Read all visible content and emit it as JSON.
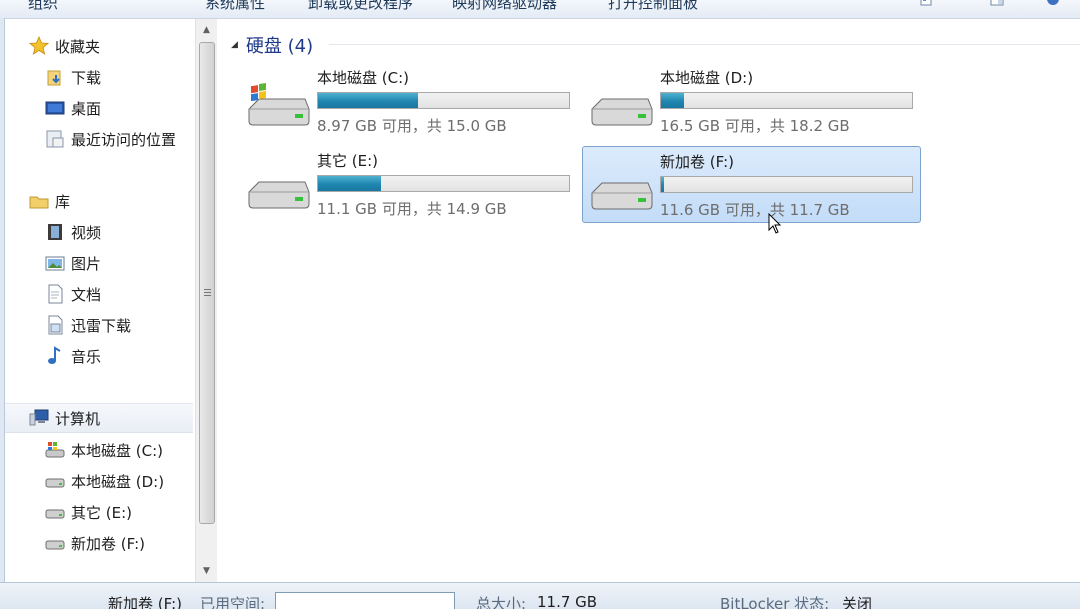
{
  "toolbar": {
    "items": [
      "组织",
      "系统属性",
      "卸载或更改程序",
      "映射网络驱动器",
      "打开控制面板"
    ]
  },
  "nav": {
    "favorites": {
      "label": "收藏夹",
      "items": [
        "下载",
        "桌面",
        "最近访问的位置"
      ]
    },
    "libraries": {
      "label": "库",
      "items": [
        "视频",
        "图片",
        "文档",
        "迅雷下载",
        "音乐"
      ]
    },
    "computer": {
      "label": "计算机",
      "items": [
        "本地磁盘 (C:)",
        "本地磁盘 (D:)",
        "其它 (E:)",
        "新加卷 (F:)"
      ]
    }
  },
  "content": {
    "group_title": "硬盘 (4)",
    "drives": [
      {
        "name": "本地磁盘 (C:)",
        "free_text": "8.97 GB 可用，共 15.0 GB",
        "used_fraction": 0.4,
        "icon": "windows-drive-icon",
        "selected": false
      },
      {
        "name": "本地磁盘 (D:)",
        "free_text": "16.5 GB 可用，共 18.2 GB",
        "used_fraction": 0.09,
        "icon": "drive-icon",
        "selected": false
      },
      {
        "name": "其它 (E:)",
        "free_text": "11.1 GB 可用，共 14.9 GB",
        "used_fraction": 0.25,
        "icon": "drive-icon",
        "selected": false
      },
      {
        "name": "新加卷 (F:)",
        "free_text": "11.6 GB 可用，共 11.7 GB",
        "used_fraction": 0.01,
        "icon": "drive-icon",
        "selected": true
      }
    ]
  },
  "details": {
    "name": "新加卷 (F:)",
    "used_label": "已用空间:",
    "total_label": "总大小:",
    "total_value": "11.7 GB",
    "bitlocker_label": "BitLocker 状态:",
    "bitlocker_value": "关闭"
  },
  "colors": {
    "bar_fill": "#1f86b0",
    "selection": "#c3dcf8",
    "group_title": "#1e3a8a"
  }
}
